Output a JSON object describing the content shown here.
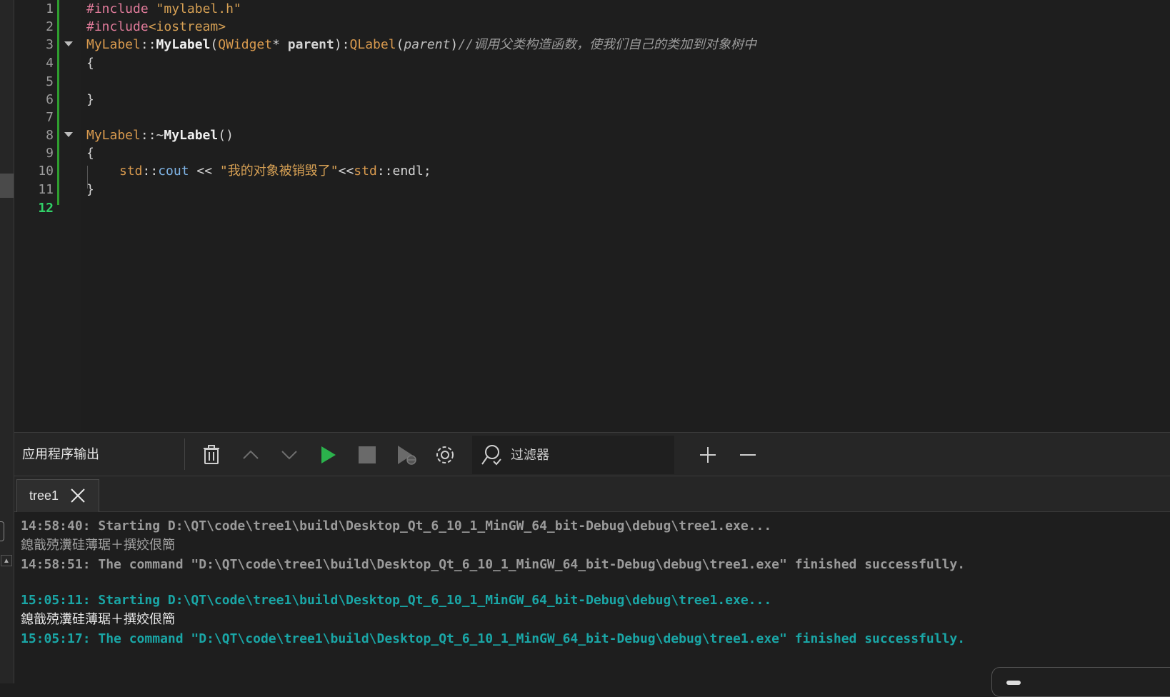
{
  "editor": {
    "line_numbers": [
      "1",
      "2",
      "3",
      "4",
      "5",
      "6",
      "7",
      "8",
      "9",
      "10",
      "11",
      "12"
    ],
    "lines": {
      "l1": {
        "pre": "#include",
        "str": "\"mylabel.h\""
      },
      "l2": {
        "pre": "#include",
        "str": "<iostream>"
      },
      "l3": {
        "class": "MyLabel",
        "scope": "::",
        "fn": "MyLabel",
        "open": "(",
        "ptype": "QWidget",
        "star": "*",
        "pname": "parent",
        "close": "):",
        "base": "QLabel",
        "bopen": "(",
        "barg": "parent",
        "bclose": ")",
        "comment": "//调用父类构造函数，使我们自己的类加到对象树中"
      },
      "l4": "{",
      "l6": "}",
      "l8": {
        "class": "MyLabel",
        "scope": "::~",
        "fn": "MyLabel",
        "parens": "()"
      },
      "l9": "{",
      "l10": {
        "ns": "std",
        "scope": "::",
        "mem": "cout",
        "op": " << ",
        "str": "\"我的对象被销毁了\"",
        "op2": "<<",
        "ns2": "std",
        "scope2": "::",
        "tail": "endl;"
      },
      "l11": "}"
    }
  },
  "output_panel": {
    "title": "应用程序输出",
    "filter_label": "过滤器",
    "tab_label": "tree1",
    "lines": [
      "14:58:40: Starting D:\\QT\\code\\tree1\\build\\Desktop_Qt_6_10_1_MinGW_64_bit-Debug\\debug\\tree1.exe...",
      "鎴戠殑瀵硅薄琚＋撰姣佷簡",
      "14:58:51: The command \"D:\\QT\\code\\tree1\\build\\Desktop_Qt_6_10_1_MinGW_64_bit-Debug\\debug\\tree1.exe\" finished successfully.",
      "15:05:11: Starting D:\\QT\\code\\tree1\\build\\Desktop_Qt_6_10_1_MinGW_64_bit-Debug\\debug\\tree1.exe...",
      "鎴戠殑瀵硅薄琚＋撰姣佷簡",
      "15:05:17: The command \"D:\\QT\\code\\tree1\\build\\Desktop_Qt_6_10_1_MinGW_64_bit-Debug\\debug\\tree1.exe\" finished successfully."
    ]
  },
  "colors": {
    "run_green": "#2bb24c",
    "success_cyan": "#1aa6a6",
    "current_line_green": "#31d168"
  },
  "icons": [
    "trash-icon",
    "chevron-up-icon",
    "chevron-down-icon",
    "run-icon",
    "stop-icon",
    "debug-run-icon",
    "gear-icon",
    "search-icon",
    "plus-icon",
    "minus-icon",
    "close-icon"
  ]
}
